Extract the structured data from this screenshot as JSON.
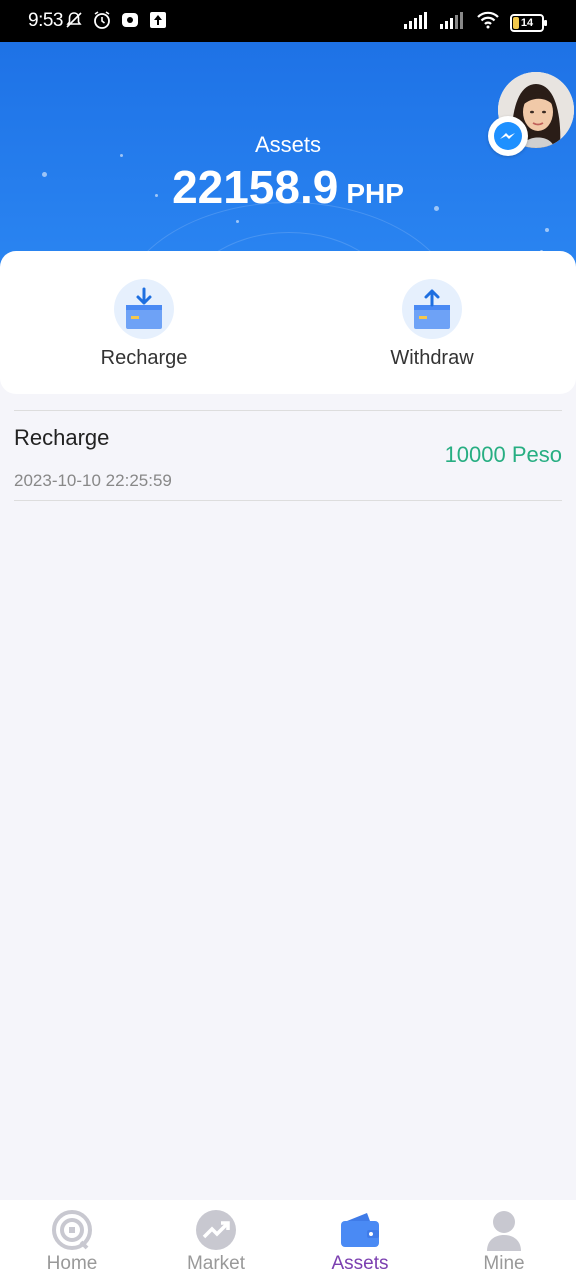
{
  "status_bar": {
    "time": "9:53",
    "battery": "14"
  },
  "header": {
    "assets_label": "Assets",
    "amount": "22158.9",
    "currency": "PHP"
  },
  "actions": [
    {
      "label": "Recharge",
      "icon": "recharge-icon"
    },
    {
      "label": "Withdraw",
      "icon": "withdraw-icon"
    }
  ],
  "records": [
    {
      "title": "Recharge",
      "date": "2023-10-10 22:25:59",
      "amount": "10000 Peso"
    }
  ],
  "tabs": [
    {
      "label": "Home",
      "icon": "home-icon",
      "active": false
    },
    {
      "label": "Market",
      "icon": "market-icon",
      "active": false
    },
    {
      "label": "Assets",
      "icon": "wallet-icon",
      "active": true
    },
    {
      "label": "Mine",
      "icon": "user-icon",
      "active": false
    }
  ],
  "colors": {
    "header_blue": "#1e72e6",
    "amount_green": "#27ae82",
    "active_tab": "#7b3fb0",
    "icon_blue": "#4a8af4"
  }
}
